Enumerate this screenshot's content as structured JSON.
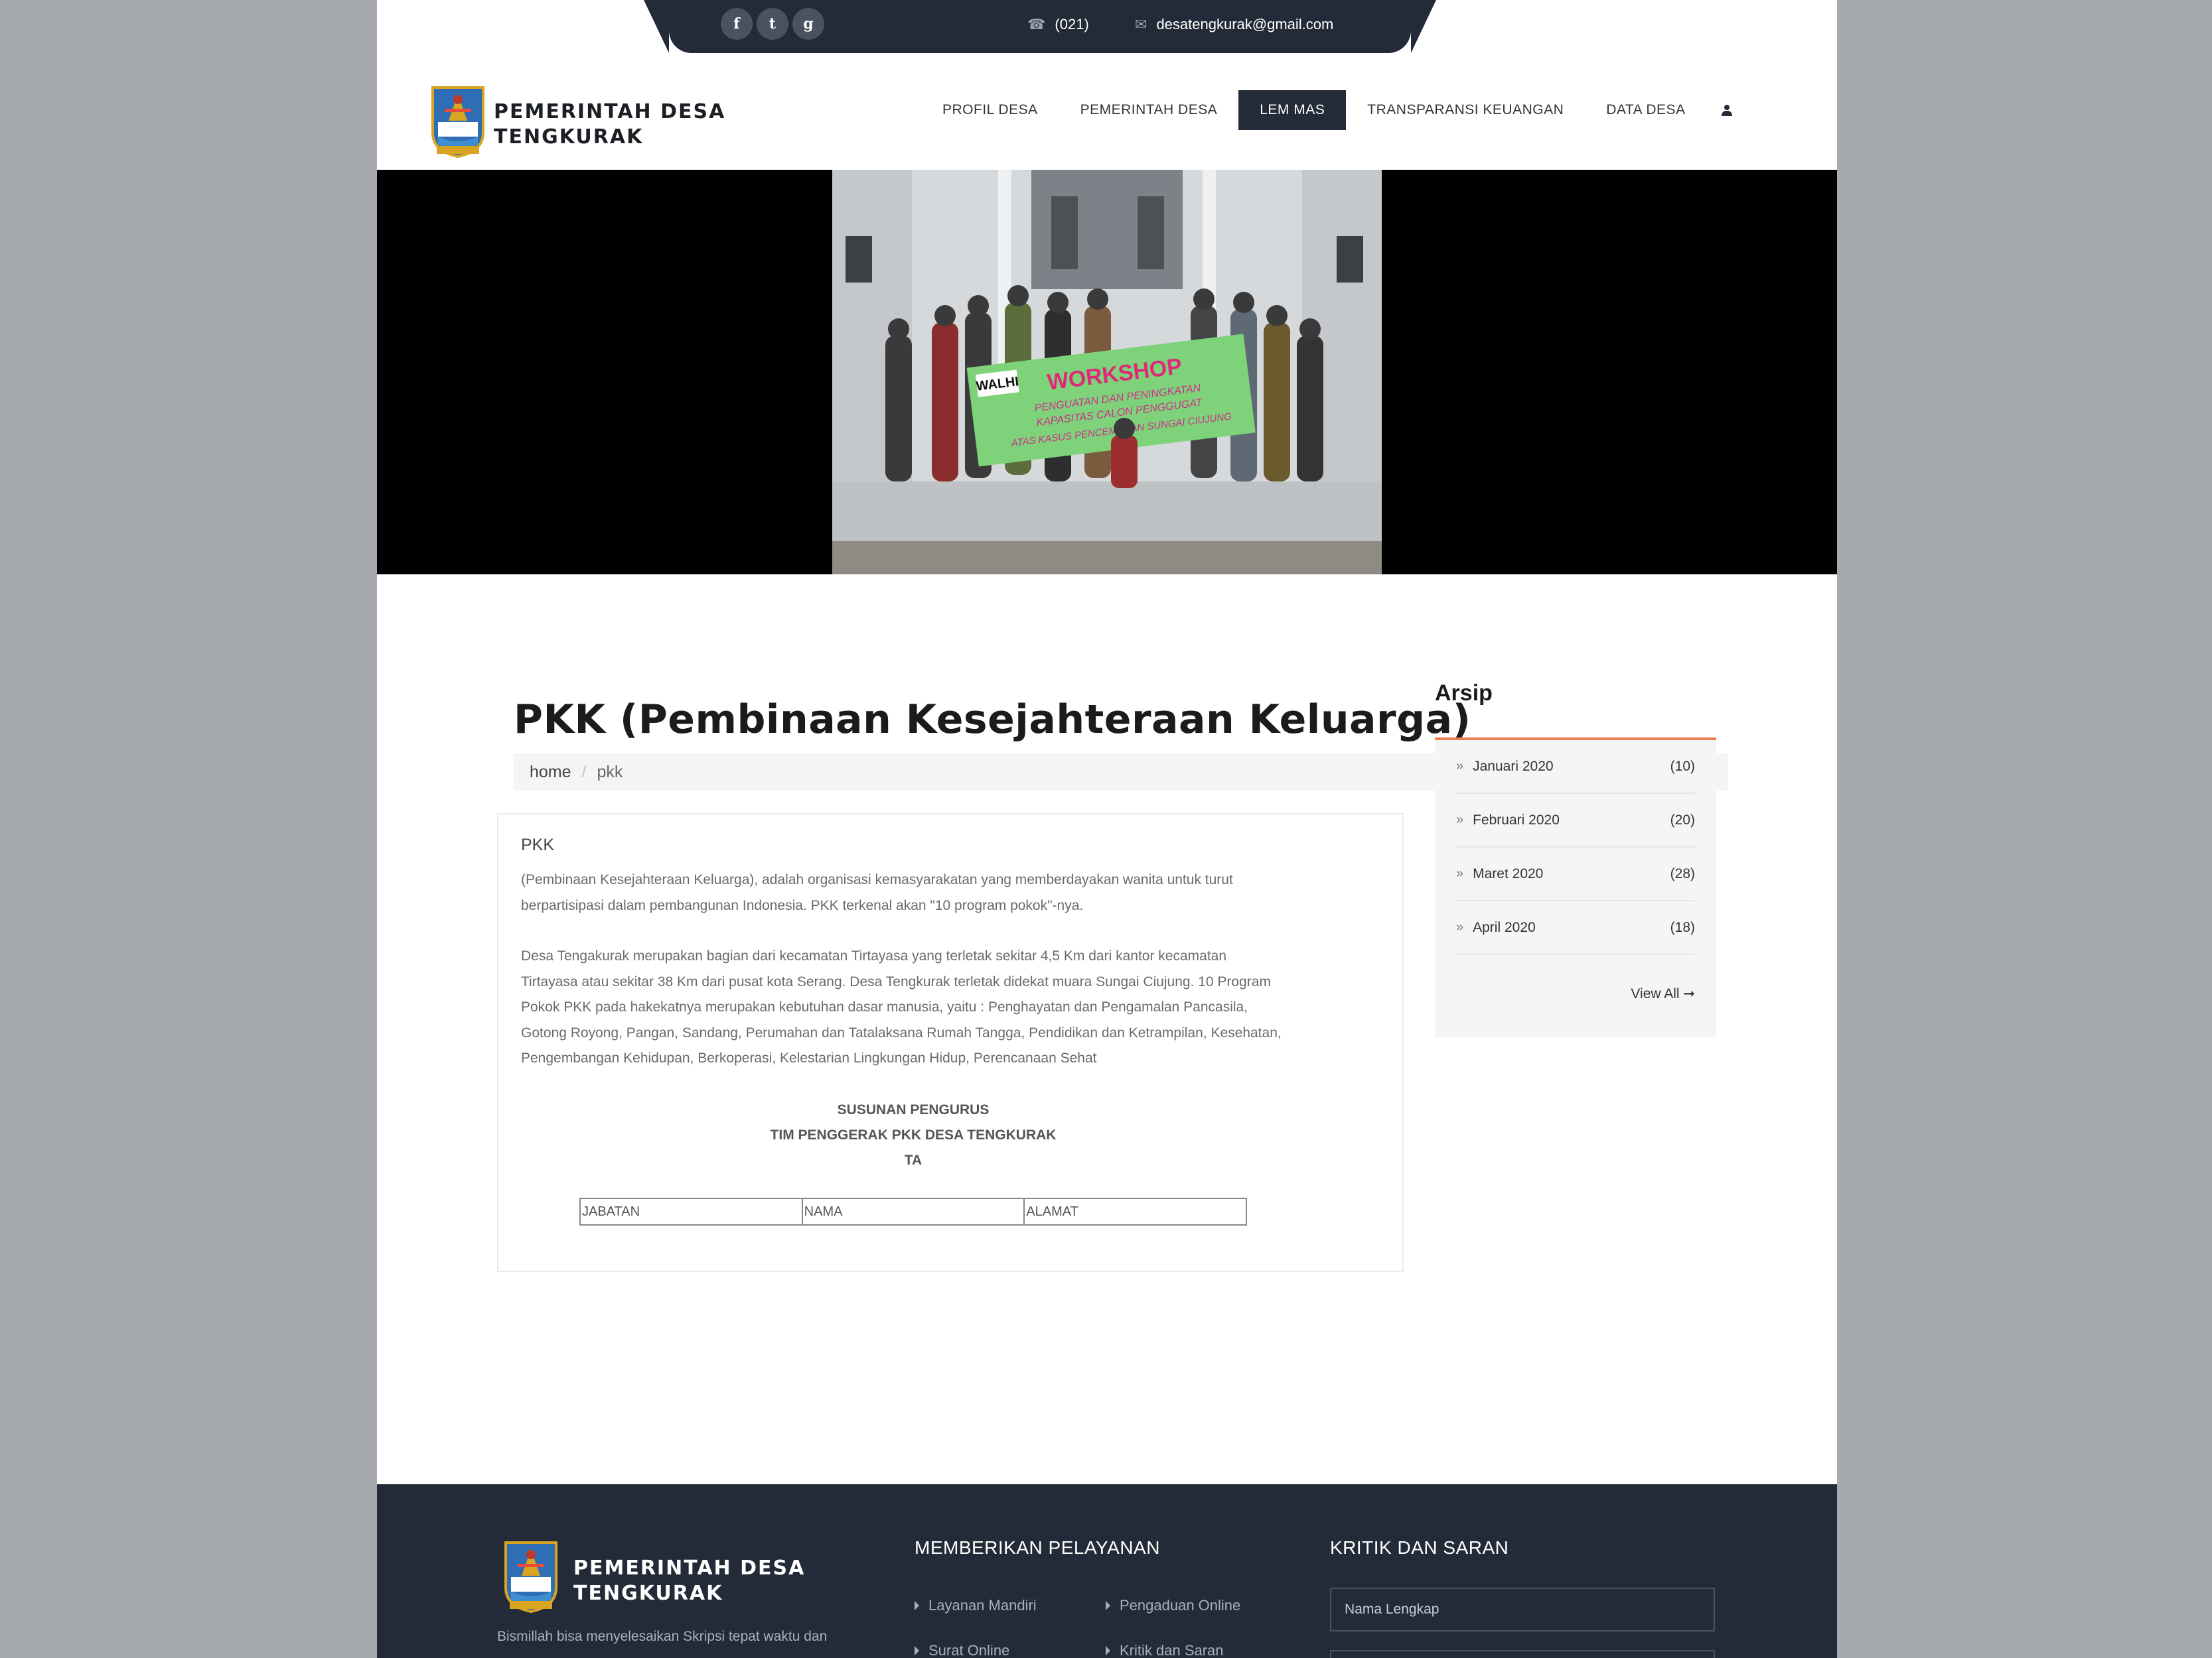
{
  "topbar": {
    "social": [
      "f",
      "t",
      "g"
    ],
    "phone": "(021)",
    "email": "desatengkurak@gmail.com"
  },
  "brand": {
    "line1": "PEMERINTAH DESA",
    "line2": "TENGKURAK"
  },
  "nav": {
    "items": [
      "PROFIL DESA",
      "PEMERINTAH DESA",
      "LEM MAS",
      "TRANSPARANSI KEUANGAN",
      "DATA DESA"
    ],
    "active": "LEM MAS"
  },
  "banner": {
    "banner_sign_title": "WORKSHOP",
    "banner_sign_logo": "WALHI",
    "banner_sign_line1": "PENGUATAN DAN PENINGKATAN",
    "banner_sign_line2": "KAPASITAS CALON PENGGUGAT",
    "banner_sign_line3": "ATAS KASUS PENCEMARAN SUNGAI CIUJUNG"
  },
  "page": {
    "title": "PKK (Pembinaan Kesejahteraan Keluarga)",
    "breadcrumb": {
      "home": "home",
      "sep": "/",
      "current": "pkk"
    }
  },
  "content": {
    "heading": "PKK",
    "para1_line1": "(Pembinaan Kesejahteraan Keluarga), adalah organisasi kemasyarakatan yang memberdayakan wanita untuk turut",
    "para1_line2": "berpartisipasi dalam pembangunan Indonesia. PKK terkenal akan \"10 program pokok\"-nya.",
    "para2_line1": "Desa Tengakurak merupakan bagian dari kecamatan Tirtayasa yang terletak sekitar 4,5 Km dari kantor kecamatan",
    "para2_line2": "Tirtayasa atau sekitar 38 Km dari pusat kota Serang. Desa Tengkurak terletak didekat muara Sungai Ciujung. 10 Program",
    "para2_line3": "Pokok PKK pada hakekatnya merupakan kebutuhan dasar manusia, yaitu : Penghayatan dan Pengamalan Pancasila,",
    "para2_line4": "Gotong Royong, Pangan, Sandang, Perumahan dan Tatalaksana Rumah Tangga, Pendidikan dan Ketrampilan, Kesehatan,",
    "para2_line5": "Pengembangan Kehidupan, Berkoperasi, Kelestarian Lingkungan Hidup, Perencanaan Sehat",
    "susunan": "SUSUNAN PENGURUS",
    "tim": "TIM PENGGERAK PKK DESA TENGKURAK",
    "ta": "TA",
    "table_headers": [
      "JABATAN",
      "NAMA",
      "ALAMAT"
    ]
  },
  "sidebar": {
    "title": "Arsip",
    "items": [
      {
        "label": "Januari 2020",
        "count": "(10)"
      },
      {
        "label": "Februari 2020",
        "count": "(20)"
      },
      {
        "label": "Maret 2020",
        "count": "(28)"
      },
      {
        "label": "April 2020",
        "count": "(18)"
      }
    ],
    "view_all": "View All ➞"
  },
  "footer": {
    "brand_line1": "PEMERINTAH DESA",
    "brand_line2": "TENGKURAK",
    "description": "Bismillah bisa menyelesaikan Skripsi tepat waktu dan",
    "services_title": "MEMBERIKAN PELAYANAN",
    "services": [
      "Layanan Mandiri",
      "Pengaduan Online",
      "Surat Online",
      "Kritik dan Saran"
    ],
    "feedback_title": "KRITIK DAN SARAN",
    "name_placeholder": "Nama Lengkap"
  },
  "colors": {
    "dark": "#232b38",
    "accent": "#ee7c4a",
    "page_bg": "#a6a9ae"
  }
}
